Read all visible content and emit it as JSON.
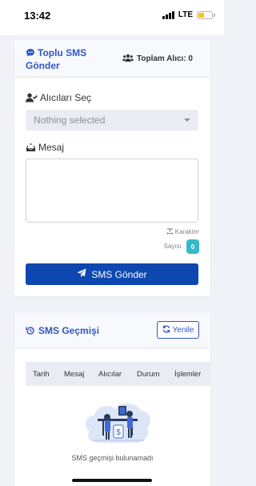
{
  "status": {
    "time": "13:42",
    "network": "LTE"
  },
  "sms_form": {
    "title_line1": "Toplu SMS",
    "title_line2": "Gönder",
    "total_recipients": "Toplam Alıcı: 0",
    "recipients_label": "Alıcıları Seç",
    "recipients_placeholder": "Nothing selected",
    "message_label": "Mesaj",
    "message_value": "",
    "char_label_line1": "Karakter",
    "char_label_line2": "Sayısı:",
    "char_count": "0",
    "send_button": "SMS Gönder"
  },
  "history": {
    "title": "SMS Geçmişi",
    "refresh_button": "Yenile",
    "columns": [
      "Tarih",
      "Mesaj",
      "Alıcılar",
      "Durum",
      "İşlemler"
    ],
    "empty_text": "SMS geçmişi bulunamadı"
  },
  "colors": {
    "primary": "#2f56c2",
    "button": "#0d47b0",
    "badge": "#36b9cc",
    "background": "#f1f2f7"
  },
  "icons": [
    "comment-dots-icon",
    "users-icon",
    "user-check-icon",
    "envelope-open-icon",
    "text-width-icon",
    "paper-plane-icon",
    "history-icon",
    "sync-icon",
    "empty-illustration"
  ]
}
